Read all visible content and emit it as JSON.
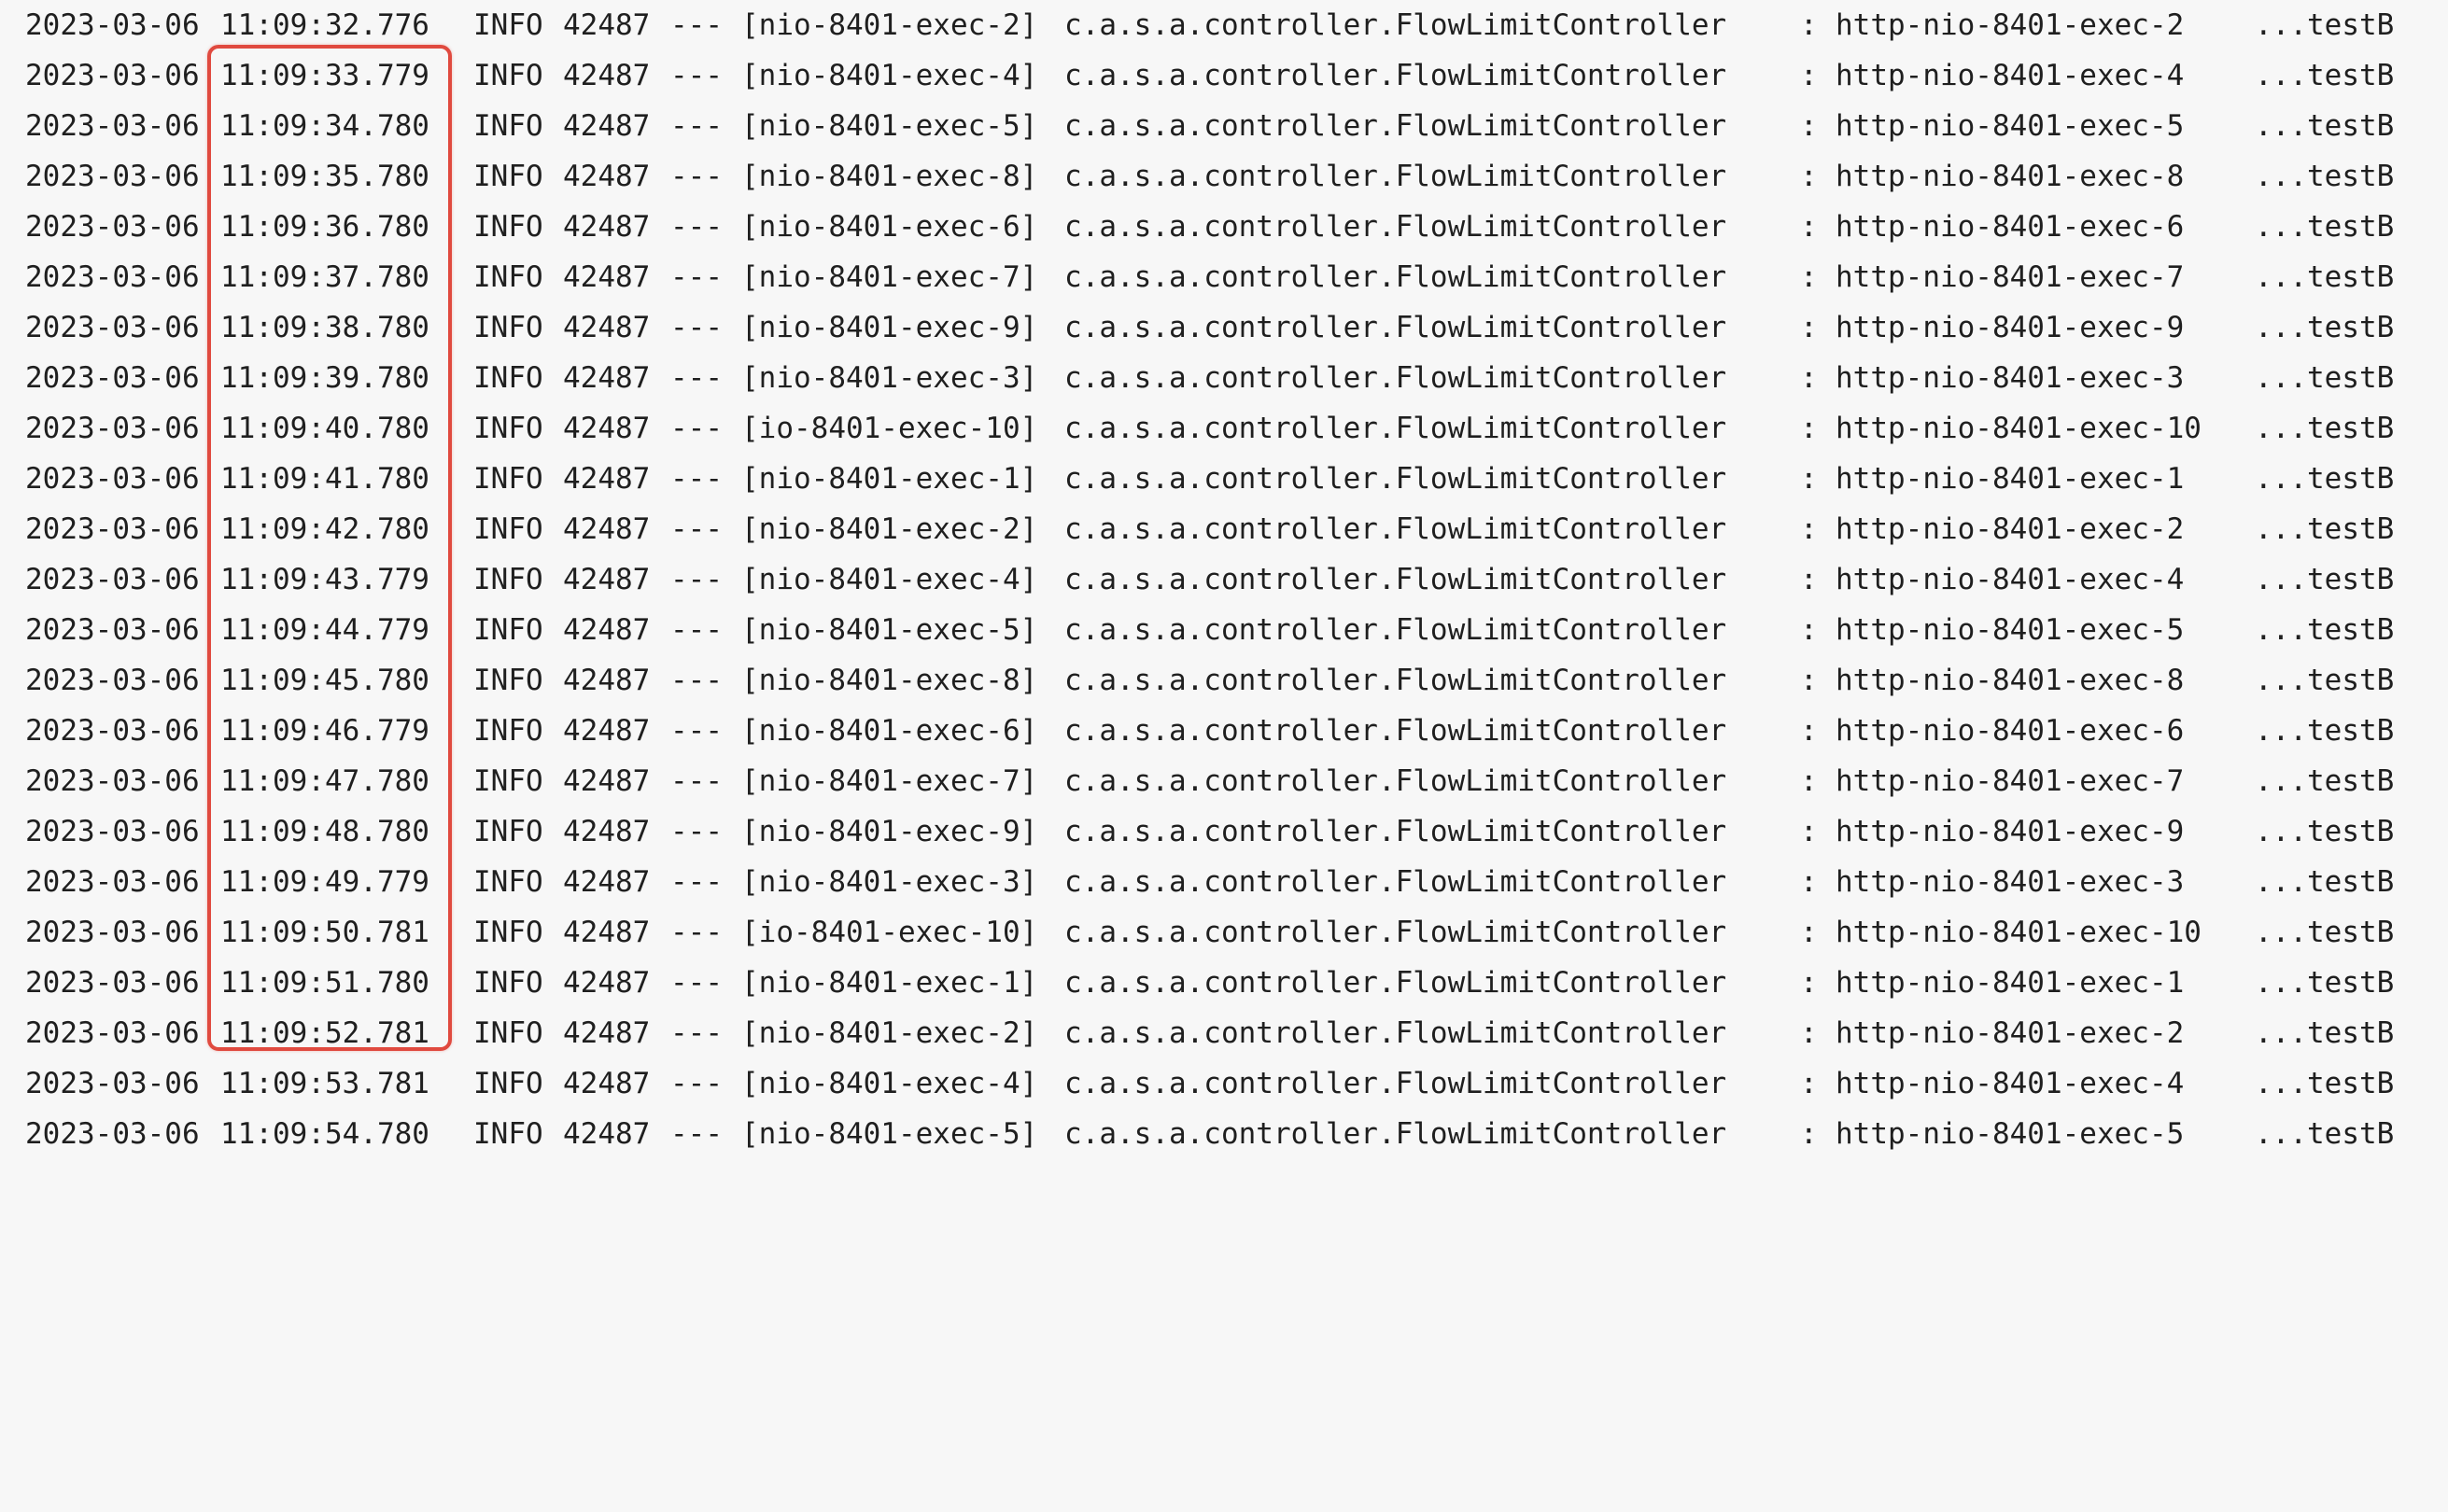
{
  "console": {
    "rows": [
      {
        "date": "2023-03-06",
        "time": "11:09:32.776",
        "level": "INFO",
        "pid": "42487",
        "sep": "---",
        "thread": "[nio-8401-exec-2]",
        "logger": "c.a.s.a.controller.FlowLimitController",
        "colon": ":",
        "message": "http-nio-8401-exec-2",
        "tail": "...testB"
      },
      {
        "date": "2023-03-06",
        "time": "11:09:33.779",
        "level": "INFO",
        "pid": "42487",
        "sep": "---",
        "thread": "[nio-8401-exec-4]",
        "logger": "c.a.s.a.controller.FlowLimitController",
        "colon": ":",
        "message": "http-nio-8401-exec-4",
        "tail": "...testB"
      },
      {
        "date": "2023-03-06",
        "time": "11:09:34.780",
        "level": "INFO",
        "pid": "42487",
        "sep": "---",
        "thread": "[nio-8401-exec-5]",
        "logger": "c.a.s.a.controller.FlowLimitController",
        "colon": ":",
        "message": "http-nio-8401-exec-5",
        "tail": "...testB"
      },
      {
        "date": "2023-03-06",
        "time": "11:09:35.780",
        "level": "INFO",
        "pid": "42487",
        "sep": "---",
        "thread": "[nio-8401-exec-8]",
        "logger": "c.a.s.a.controller.FlowLimitController",
        "colon": ":",
        "message": "http-nio-8401-exec-8",
        "tail": "...testB"
      },
      {
        "date": "2023-03-06",
        "time": "11:09:36.780",
        "level": "INFO",
        "pid": "42487",
        "sep": "---",
        "thread": "[nio-8401-exec-6]",
        "logger": "c.a.s.a.controller.FlowLimitController",
        "colon": ":",
        "message": "http-nio-8401-exec-6",
        "tail": "...testB"
      },
      {
        "date": "2023-03-06",
        "time": "11:09:37.780",
        "level": "INFO",
        "pid": "42487",
        "sep": "---",
        "thread": "[nio-8401-exec-7]",
        "logger": "c.a.s.a.controller.FlowLimitController",
        "colon": ":",
        "message": "http-nio-8401-exec-7",
        "tail": "...testB"
      },
      {
        "date": "2023-03-06",
        "time": "11:09:38.780",
        "level": "INFO",
        "pid": "42487",
        "sep": "---",
        "thread": "[nio-8401-exec-9]",
        "logger": "c.a.s.a.controller.FlowLimitController",
        "colon": ":",
        "message": "http-nio-8401-exec-9",
        "tail": "...testB"
      },
      {
        "date": "2023-03-06",
        "time": "11:09:39.780",
        "level": "INFO",
        "pid": "42487",
        "sep": "---",
        "thread": "[nio-8401-exec-3]",
        "logger": "c.a.s.a.controller.FlowLimitController",
        "colon": ":",
        "message": "http-nio-8401-exec-3",
        "tail": "...testB"
      },
      {
        "date": "2023-03-06",
        "time": "11:09:40.780",
        "level": "INFO",
        "pid": "42487",
        "sep": "---",
        "thread": "[io-8401-exec-10]",
        "logger": "c.a.s.a.controller.FlowLimitController",
        "colon": ":",
        "message": "http-nio-8401-exec-10",
        "tail": "...testB"
      },
      {
        "date": "2023-03-06",
        "time": "11:09:41.780",
        "level": "INFO",
        "pid": "42487",
        "sep": "---",
        "thread": "[nio-8401-exec-1]",
        "logger": "c.a.s.a.controller.FlowLimitController",
        "colon": ":",
        "message": "http-nio-8401-exec-1",
        "tail": "...testB"
      },
      {
        "date": "2023-03-06",
        "time": "11:09:42.780",
        "level": "INFO",
        "pid": "42487",
        "sep": "---",
        "thread": "[nio-8401-exec-2]",
        "logger": "c.a.s.a.controller.FlowLimitController",
        "colon": ":",
        "message": "http-nio-8401-exec-2",
        "tail": "...testB"
      },
      {
        "date": "2023-03-06",
        "time": "11:09:43.779",
        "level": "INFO",
        "pid": "42487",
        "sep": "---",
        "thread": "[nio-8401-exec-4]",
        "logger": "c.a.s.a.controller.FlowLimitController",
        "colon": ":",
        "message": "http-nio-8401-exec-4",
        "tail": "...testB"
      },
      {
        "date": "2023-03-06",
        "time": "11:09:44.779",
        "level": "INFO",
        "pid": "42487",
        "sep": "---",
        "thread": "[nio-8401-exec-5]",
        "logger": "c.a.s.a.controller.FlowLimitController",
        "colon": ":",
        "message": "http-nio-8401-exec-5",
        "tail": "...testB"
      },
      {
        "date": "2023-03-06",
        "time": "11:09:45.780",
        "level": "INFO",
        "pid": "42487",
        "sep": "---",
        "thread": "[nio-8401-exec-8]",
        "logger": "c.a.s.a.controller.FlowLimitController",
        "colon": ":",
        "message": "http-nio-8401-exec-8",
        "tail": "...testB"
      },
      {
        "date": "2023-03-06",
        "time": "11:09:46.779",
        "level": "INFO",
        "pid": "42487",
        "sep": "---",
        "thread": "[nio-8401-exec-6]",
        "logger": "c.a.s.a.controller.FlowLimitController",
        "colon": ":",
        "message": "http-nio-8401-exec-6",
        "tail": "...testB"
      },
      {
        "date": "2023-03-06",
        "time": "11:09:47.780",
        "level": "INFO",
        "pid": "42487",
        "sep": "---",
        "thread": "[nio-8401-exec-7]",
        "logger": "c.a.s.a.controller.FlowLimitController",
        "colon": ":",
        "message": "http-nio-8401-exec-7",
        "tail": "...testB"
      },
      {
        "date": "2023-03-06",
        "time": "11:09:48.780",
        "level": "INFO",
        "pid": "42487",
        "sep": "---",
        "thread": "[nio-8401-exec-9]",
        "logger": "c.a.s.a.controller.FlowLimitController",
        "colon": ":",
        "message": "http-nio-8401-exec-9",
        "tail": "...testB"
      },
      {
        "date": "2023-03-06",
        "time": "11:09:49.779",
        "level": "INFO",
        "pid": "42487",
        "sep": "---",
        "thread": "[nio-8401-exec-3]",
        "logger": "c.a.s.a.controller.FlowLimitController",
        "colon": ":",
        "message": "http-nio-8401-exec-3",
        "tail": "...testB"
      },
      {
        "date": "2023-03-06",
        "time": "11:09:50.781",
        "level": "INFO",
        "pid": "42487",
        "sep": "---",
        "thread": "[io-8401-exec-10]",
        "logger": "c.a.s.a.controller.FlowLimitController",
        "colon": ":",
        "message": "http-nio-8401-exec-10",
        "tail": "...testB"
      },
      {
        "date": "2023-03-06",
        "time": "11:09:51.780",
        "level": "INFO",
        "pid": "42487",
        "sep": "---",
        "thread": "[nio-8401-exec-1]",
        "logger": "c.a.s.a.controller.FlowLimitController",
        "colon": ":",
        "message": "http-nio-8401-exec-1",
        "tail": "...testB"
      },
      {
        "date": "2023-03-06",
        "time": "11:09:52.781",
        "level": "INFO",
        "pid": "42487",
        "sep": "---",
        "thread": "[nio-8401-exec-2]",
        "logger": "c.a.s.a.controller.FlowLimitController",
        "colon": ":",
        "message": "http-nio-8401-exec-2",
        "tail": "...testB"
      },
      {
        "date": "2023-03-06",
        "time": "11:09:53.781",
        "level": "INFO",
        "pid": "42487",
        "sep": "---",
        "thread": "[nio-8401-exec-4]",
        "logger": "c.a.s.a.controller.FlowLimitController",
        "colon": ":",
        "message": "http-nio-8401-exec-4",
        "tail": "...testB"
      },
      {
        "date": "2023-03-06",
        "time": "11:09:54.780",
        "level": "INFO",
        "pid": "42487",
        "sep": "---",
        "thread": "[nio-8401-exec-5]",
        "logger": "c.a.s.a.controller.FlowLimitController",
        "colon": ":",
        "message": "http-nio-8401-exec-5",
        "tail": "...testB"
      }
    ]
  },
  "colors": {
    "background": "#f7f7f7",
    "text": "#1f1f1f",
    "highlight_border": "#e04a3f"
  }
}
